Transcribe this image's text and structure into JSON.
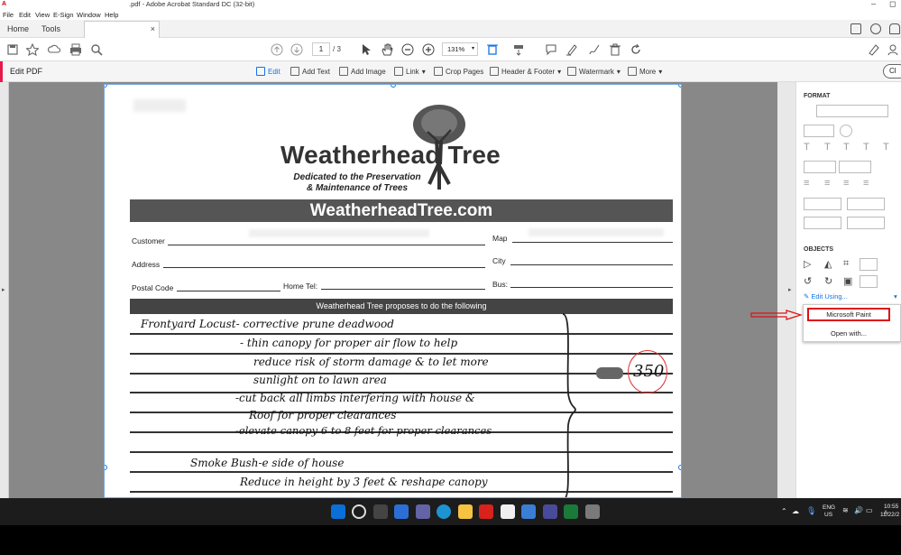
{
  "window": {
    "title": ".pdf - Adobe Acrobat Standard DC (32-bit)"
  },
  "menu": [
    "File",
    "Edit",
    "View",
    "E-Sign",
    "Window",
    "Help"
  ],
  "tabs": {
    "home": "Home",
    "tools": "Tools",
    "document_close": "×"
  },
  "toolbar": {
    "page_current": "1",
    "page_total": "/ 3",
    "zoom": "131%"
  },
  "edit_bar": {
    "title": "Edit PDF",
    "tools": [
      {
        "label": "Edit",
        "icon": "edit-icon",
        "active": true
      },
      {
        "label": "Add Text",
        "icon": "text-icon"
      },
      {
        "label": "Add Image",
        "icon": "image-icon"
      },
      {
        "label": "Link",
        "icon": "link-icon"
      },
      {
        "label": "Crop Pages",
        "icon": "crop-icon"
      },
      {
        "label": "Header & Footer",
        "icon": "header-footer-icon"
      },
      {
        "label": "Watermark",
        "icon": "watermark-icon"
      },
      {
        "label": "More",
        "icon": "more-icon"
      }
    ],
    "close_label": "Cl"
  },
  "document": {
    "logo_text": "Weatherhead Tree",
    "tagline_line1": "Dedicated to the Preservation",
    "tagline_line2": "& Maintenance of Trees",
    "banner": "WeatherheadTree.com",
    "fields": {
      "customer": "Customer",
      "map": "Map",
      "address": "Address",
      "city": "City",
      "postal_code": "Postal Code",
      "home_tel": "Home Tel:",
      "bus": "Bus:"
    },
    "proposal_header": "Weatherhead Tree proposes to do the following",
    "handwriting": [
      "Frontyard Locust- corrective prune deadwood",
      "- thin canopy for proper air flow to help",
      "reduce risk of storm damage & to let more",
      "sunlight on to lawn area",
      "-cut back all limbs interfering with house &",
      "Roof for proper clearances",
      "-elevate canopy 6 to 8 feet for proper clearances",
      "Smoke Bush-e side of house",
      "Reduce in height by 3 feet & reshape canopy"
    ],
    "price": "350"
  },
  "right_panel": {
    "format_header": "FORMAT",
    "objects_header": "OBJECTS",
    "edit_using": "Edit Using...",
    "menu_items": [
      "Microsoft Paint",
      "Open with..."
    ]
  },
  "taskbar": {
    "lang_line1": "ENG",
    "lang_line2": "US",
    "time": "10:55 A",
    "date": "11/22/2"
  },
  "colors": {
    "accent_blue": "#1473e6",
    "edit_accent": "#e6194b",
    "highlight_red": "#d11111"
  }
}
